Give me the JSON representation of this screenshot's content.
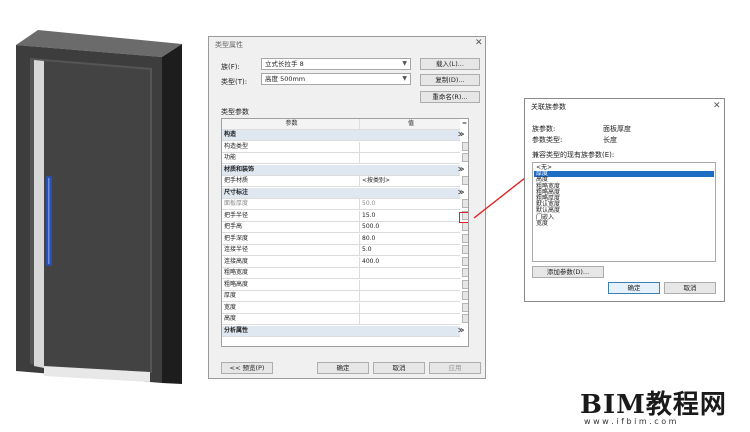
{
  "type_props": {
    "title": "类型属性",
    "family_label": "族(F):",
    "family_value": "立式长拉手 8",
    "type_label": "类型(T):",
    "type_value": "高度 500mm",
    "load_btn": "载入(L)...",
    "duplicate_btn": "复制(D)...",
    "rename_btn": "重命名(R)...",
    "section_label": "类型参数",
    "col_param": "参数",
    "col_value": "值",
    "col_eq": "=",
    "rows": [
      {
        "kind": "group",
        "name": "构造",
        "mark": "≫"
      },
      {
        "kind": "row",
        "name": "构造类型",
        "value": ""
      },
      {
        "kind": "row",
        "name": "功能",
        "value": ""
      },
      {
        "kind": "group",
        "name": "材质和装饰",
        "mark": "≫"
      },
      {
        "kind": "row",
        "name": "把手材质",
        "value": "<按类别>"
      },
      {
        "kind": "group",
        "name": "尺寸标注",
        "mark": "≫"
      },
      {
        "kind": "row",
        "name": "面板厚度",
        "value": "50.0"
      },
      {
        "kind": "row",
        "name": "把手半径",
        "value": "15.0"
      },
      {
        "kind": "row",
        "name": "把手高",
        "value": "500.0"
      },
      {
        "kind": "row",
        "name": "把手深度",
        "value": "80.0"
      },
      {
        "kind": "row",
        "name": "连接半径",
        "value": "5.0"
      },
      {
        "kind": "row",
        "name": "连接高度",
        "value": "400.0"
      },
      {
        "kind": "row",
        "name": "粗略宽度",
        "value": ""
      },
      {
        "kind": "row",
        "name": "粗略高度",
        "value": ""
      },
      {
        "kind": "row",
        "name": "厚度",
        "value": ""
      },
      {
        "kind": "row",
        "name": "宽度",
        "value": ""
      },
      {
        "kind": "row",
        "name": "高度",
        "value": ""
      },
      {
        "kind": "group",
        "name": "分析属性",
        "mark": "≫"
      }
    ],
    "preview_btn": "<< 预览(P)",
    "ok_btn": "确定",
    "cancel_btn": "取消",
    "apply_btn": "应用"
  },
  "assoc": {
    "title": "关联族参数",
    "family_param_label": "族参数:",
    "family_param_value": "面板厚度",
    "param_type_label": "参数类型:",
    "param_type_value": "长度",
    "compatible_label": "兼容类型的现有族参数(E):",
    "items": [
      "<无>",
      "厚度",
      "高度",
      "粗略宽度",
      "粗略高度",
      "粗略厚度",
      "默认宽度",
      "默认高度",
      "门嵌入",
      "宽度"
    ],
    "selected_index": 1,
    "add_param_btn": "添加参数(D)...",
    "ok_btn": "确定",
    "cancel_btn": "取消"
  },
  "watermark": {
    "title": "BIM教程网",
    "url": "w w w . i f b i m . c o m"
  },
  "colors": {
    "arrow": "#e02020",
    "selection": "#1f6cc5",
    "handle": "#2a4fb5"
  }
}
